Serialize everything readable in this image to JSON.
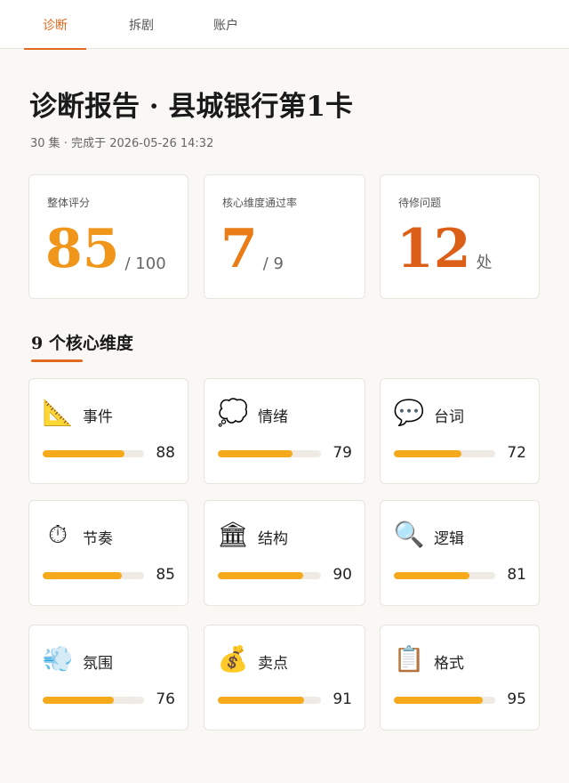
{
  "tabs": [
    {
      "label": "诊断",
      "active": true
    },
    {
      "label": "拆剧",
      "active": false
    },
    {
      "label": "账户",
      "active": false
    }
  ],
  "report": {
    "title": "诊断报告 · 县城银行第1卡",
    "meta": "30 集 · 完成于 2026-05-26 14:32"
  },
  "stats": [
    {
      "label": "整体评分",
      "value": "85",
      "suffix": "/ 100",
      "color": "#f0961b"
    },
    {
      "label": "核心维度通过率",
      "value": "7",
      "suffix": "/ 9",
      "color": "#ea7c18"
    },
    {
      "label": "待修问题",
      "value": "12",
      "suffix": "处",
      "color": "#dc5f17"
    }
  ],
  "section_title": "9 个核心维度",
  "colors": {
    "accent": "#e2691e",
    "bar": "#f5a91b",
    "track": "#efebe4"
  },
  "dimensions": [
    {
      "name": "事件",
      "score": "88",
      "icon": "📐",
      "icon_name": "triangle-ruler-icon"
    },
    {
      "name": "情绪",
      "score": "79",
      "icon": "💭",
      "icon_name": "thought-bubble-icon"
    },
    {
      "name": "台词",
      "score": "72",
      "icon": "💬",
      "icon_name": "speech-bubble-icon"
    },
    {
      "name": "节奏",
      "score": "85",
      "icon": "⏱",
      "icon_name": "stopwatch-icon"
    },
    {
      "name": "结构",
      "score": "90",
      "icon": "🏛",
      "icon_name": "classical-building-icon"
    },
    {
      "name": "逻辑",
      "score": "81",
      "icon": "🔍",
      "icon_name": "magnifier-icon"
    },
    {
      "name": "氛围",
      "score": "76",
      "icon": "💨",
      "icon_name": "cloud-icon"
    },
    {
      "name": "卖点",
      "score": "91",
      "icon": "💰",
      "icon_name": "money-bag-icon"
    },
    {
      "name": "格式",
      "score": "95",
      "icon": "📋",
      "icon_name": "clipboard-icon"
    }
  ]
}
